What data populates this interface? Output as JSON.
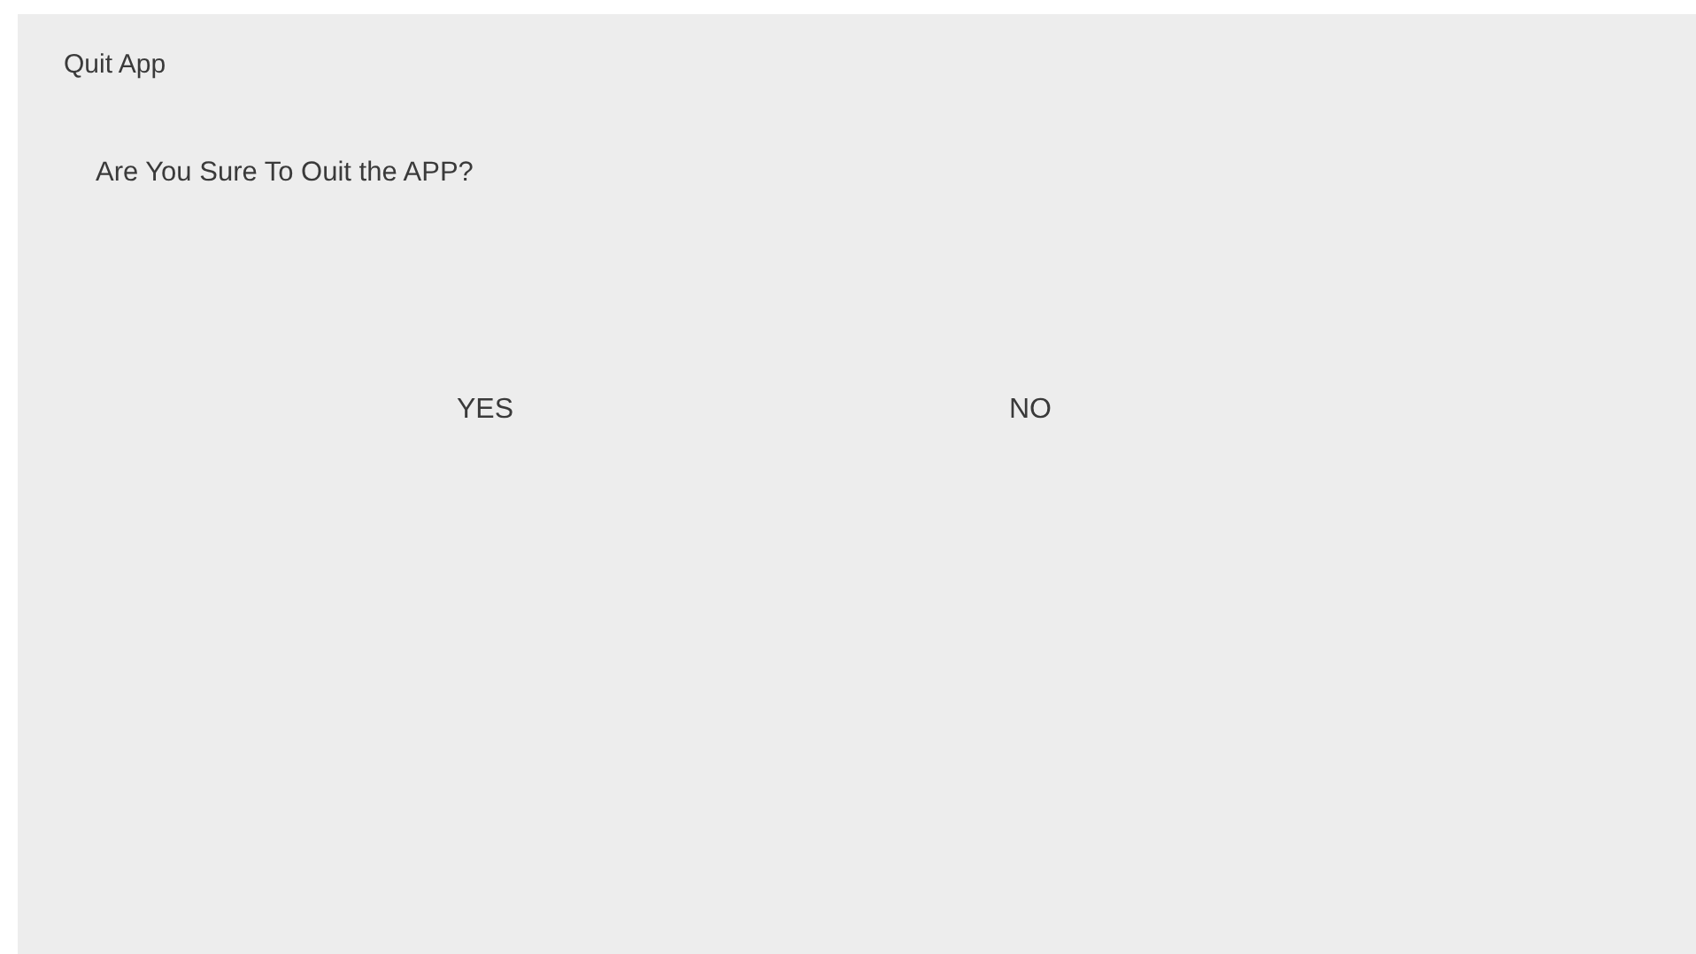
{
  "dialog": {
    "title": "Quit App",
    "message": "Are You Sure To Ouit the APP?",
    "buttons": [
      {
        "label": "YES"
      },
      {
        "label": "NO"
      }
    ]
  }
}
